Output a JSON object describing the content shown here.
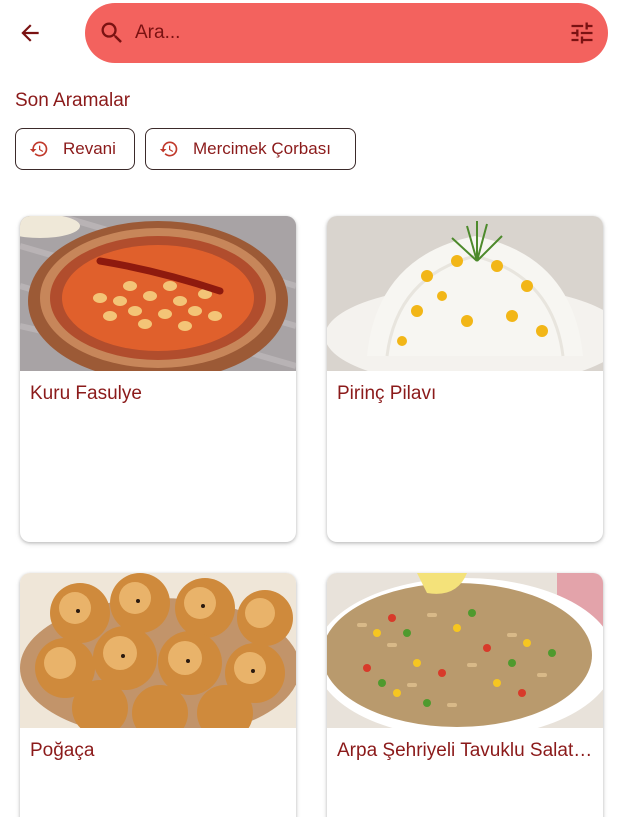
{
  "header": {
    "back_icon": "arrow-back-icon",
    "search": {
      "placeholder": "Ara...",
      "value": "",
      "search_icon": "search-icon",
      "filter_icon": "tune-icon"
    }
  },
  "recent": {
    "title": "Son Aramalar",
    "chips": [
      {
        "label": "Revani",
        "icon": "history-icon"
      },
      {
        "label": "Mercimek Çorbası",
        "icon": "history-icon"
      }
    ]
  },
  "recipes": [
    {
      "title": "Kuru Fasulye"
    },
    {
      "title": "Pirinç Pilavı"
    },
    {
      "title": "Poğaça"
    },
    {
      "title": "Arpa Şehriyeli Tavuklu Salatası"
    }
  ],
  "colors": {
    "accent": "#f3625e",
    "text": "#8b1a1a",
    "icon": "#7a1212"
  }
}
